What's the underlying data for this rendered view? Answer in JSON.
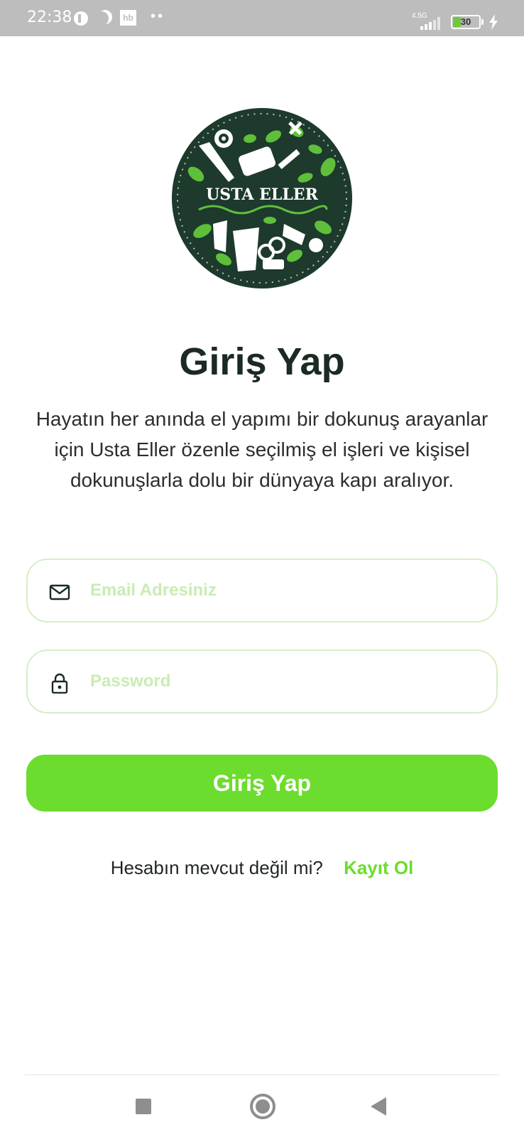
{
  "status_bar": {
    "time": "22:38",
    "hb_label": "hb",
    "dots": "••",
    "network": "4.5G",
    "battery": "30",
    "battery_level": 0.3
  },
  "logo": {
    "text": "USTA ELLER",
    "bg_color": "#1d3a2c",
    "leaf_color": "#5fbf3a"
  },
  "header": {
    "title": "Giriş Yap",
    "description": "Hayatın her anında el yapımı bir dokunuş arayanlar için Usta Eller özenle seçilmiş el işleri ve kişisel dokunuşlarla dolu bir dünyaya kapı aralıyor."
  },
  "form": {
    "email": {
      "placeholder": "Email Adresiniz",
      "value": "",
      "icon": "mail-icon"
    },
    "password": {
      "placeholder": "Password",
      "value": "",
      "icon": "lock-icon"
    },
    "submit_label": "Giriş Yap"
  },
  "signup": {
    "question": "Hesabın mevcut değil mi?",
    "link": "Kayıt Ol"
  },
  "colors": {
    "accent": "#6cdc2e",
    "field_border": "#d6efc5",
    "placeholder": "#c9ecb3",
    "title": "#1b2a22"
  }
}
